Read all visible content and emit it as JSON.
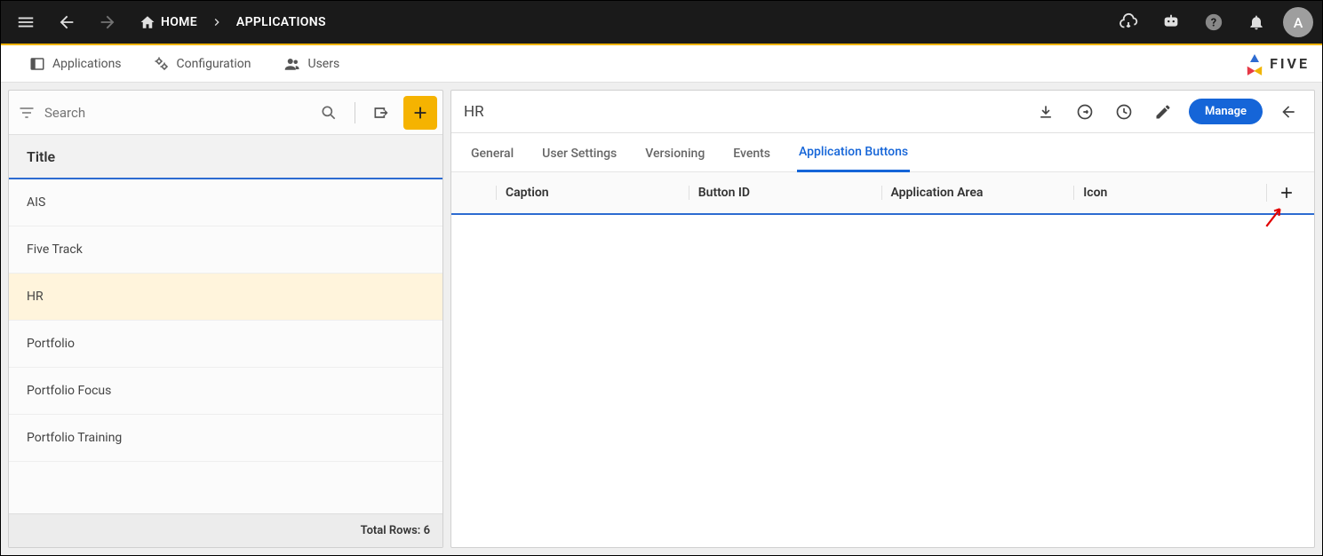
{
  "breadcrumb": {
    "home": "HOME",
    "current": "APPLICATIONS"
  },
  "avatar_initial": "A",
  "modulenav": {
    "applications": "Applications",
    "configuration": "Configuration",
    "users": "Users",
    "brand": "FIVE"
  },
  "search": {
    "placeholder": "Search"
  },
  "list": {
    "header": "Title",
    "rows": [
      "AIS",
      "Five Track",
      "HR",
      "Portfolio",
      "Portfolio Focus",
      "Portfolio Training"
    ],
    "selectedIndex": 2,
    "footer_label": "Total Rows:",
    "footer_count": "6"
  },
  "detail": {
    "title": "HR",
    "manage": "Manage",
    "tabs": [
      "General",
      "User Settings",
      "Versioning",
      "Events",
      "Application Buttons"
    ],
    "active_tab": 4,
    "columns": [
      "Caption",
      "Button ID",
      "Application Area",
      "Icon"
    ]
  }
}
